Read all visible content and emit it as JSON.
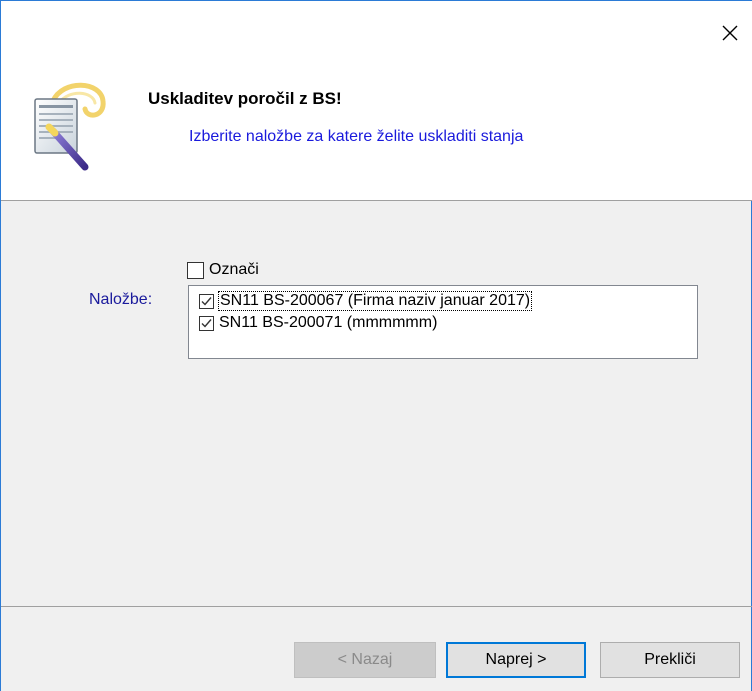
{
  "header": {
    "title": "Uskladitev poročil z BS!",
    "subtitle": "Izberite naložbe za katere želite uskladiti stanja",
    "close_icon": "close-icon",
    "wizard_icon": "wizard-document-icon"
  },
  "form": {
    "select_all_label": "Označi",
    "select_all_checked": false,
    "list_label": "Naložbe:",
    "items": [
      {
        "label": "SN11 BS-200067 (Firma naziv januar 2017)",
        "checked": true
      },
      {
        "label": "SN11 BS-200071 (mmmmmm)",
        "checked": true
      }
    ]
  },
  "buttons": {
    "back": "< Nazaj",
    "next": "Naprej >",
    "cancel": "Prekliči"
  },
  "colors": {
    "accent": "#0078d7",
    "subtitle": "#1a1adc",
    "label": "#1a1a9c"
  }
}
